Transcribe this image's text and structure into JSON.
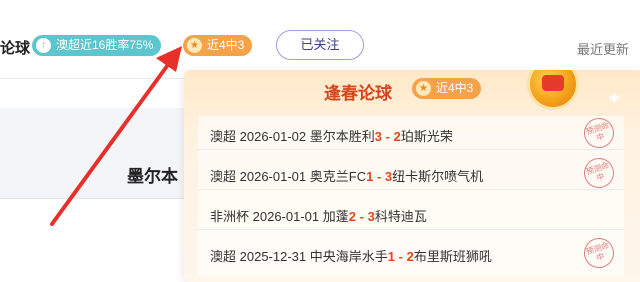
{
  "header": {
    "title_fragment": "论球",
    "streak_badge": "澳超近16胜率75%",
    "recent_badge": "近4中3",
    "follow_button": "已关注",
    "recent_update": "最近更新"
  },
  "background": {
    "team_fragment": "墨尔本"
  },
  "popup": {
    "title": "逢春论球",
    "badge": "近4中3",
    "stamp_text": "预测命中",
    "items": [
      {
        "league": "澳超",
        "date": "2026-01-02",
        "home": "墨尔本胜利",
        "home_score": "3",
        "sep": " - ",
        "away_score": "2",
        "away": "珀斯光荣",
        "hit": true
      },
      {
        "league": "澳超",
        "date": "2026-01-01",
        "home": "奥克兰FC",
        "home_score": "1",
        "sep": " - ",
        "away_score": "3",
        "away": "纽卡斯尔喷气机",
        "hit": true
      },
      {
        "league": "非洲杯",
        "date": "2026-01-01",
        "home": "加蓬",
        "home_score": "2",
        "sep": " - ",
        "away_score": "3",
        "away": "科特迪瓦",
        "hit": false
      },
      {
        "league": "澳超",
        "date": "2025-12-31",
        "home": "中央海岸水手",
        "home_score": "1",
        "sep": " - ",
        "away_score": "2",
        "away": "布里斯班狮吼",
        "hit": true
      }
    ]
  },
  "colors": {
    "accent_orange": "#f6a248",
    "accent_teal": "#5cc6cf",
    "score_red": "#e8451c",
    "arrow_red": "#e8302a"
  }
}
